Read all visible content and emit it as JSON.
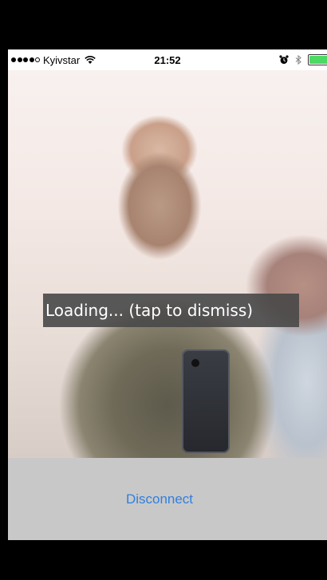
{
  "status_bar": {
    "carrier": "Kyivstar",
    "time": "21:52",
    "signal_bars_filled": 4,
    "signal_bars_total": 5,
    "icons": [
      "wifi-icon",
      "alarm-icon",
      "bluetooth-icon",
      "battery-icon"
    ],
    "battery_color": "#4cd964"
  },
  "video": {
    "overlay_text": "Loading... (tap to dismiss)"
  },
  "bottom_panel": {
    "disconnect_label": "Disconnect",
    "accent_color": "#2f7fe0"
  }
}
